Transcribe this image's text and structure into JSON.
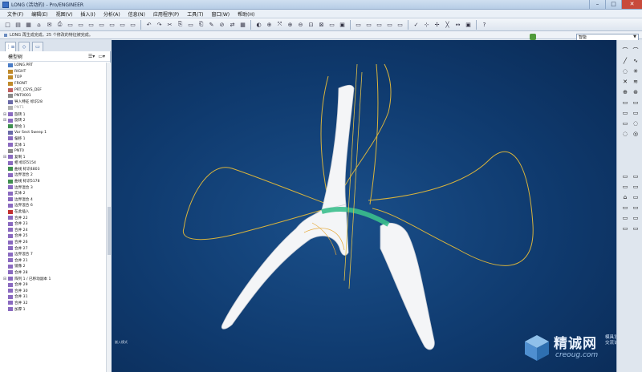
{
  "window": {
    "title": "LONG (活动的) - Pro/ENGINEER",
    "min": "–",
    "max": "□",
    "close": "✕"
  },
  "menu": [
    "文件(F)",
    "编辑(E)",
    "视图(V)",
    "插入(I)",
    "分析(A)",
    "信息(N)",
    "应用程序(P)",
    "工具(T)",
    "窗口(W)",
    "帮助(H)"
  ],
  "toolbar": {
    "groups": [
      [
        "□",
        "▤",
        "▦",
        "⌂",
        "✉",
        "⎙",
        "▭",
        "▭",
        "▭",
        "▭",
        "▭",
        "▭",
        "▭"
      ],
      [
        "↶",
        "↷",
        "✂",
        "⎘",
        "▭",
        "⎗",
        "✎",
        "⊘",
        "⇄",
        "▦"
      ],
      [
        "◐",
        "⊕",
        "⤧",
        "⊕",
        "⊖",
        "⊡",
        "⊠",
        "▭",
        "▣"
      ],
      [
        "▭",
        "▭",
        "▭",
        "▭",
        "▭"
      ],
      [
        "✓",
        "⊹",
        "✢",
        "╳",
        "↔",
        "▣"
      ],
      [
        "?"
      ]
    ]
  },
  "message": "LONG 再生成完成。25 个修改的特征被完成。",
  "filter": {
    "selected": "智能",
    "arrow": "▼"
  },
  "navigator": {
    "tabs": [
      "⋮≡",
      "◇",
      "▭"
    ],
    "header": "模型树",
    "tools": [
      "☰▾",
      "▭▾"
    ],
    "items": [
      {
        "label": "LONG.PRT",
        "twist": "",
        "icon": "#4a7cc6"
      },
      {
        "label": "RIGHT",
        "twist": "",
        "icon": "#c08a2a"
      },
      {
        "label": "TOP",
        "twist": "",
        "icon": "#c08a2a"
      },
      {
        "label": "FRONT",
        "twist": "",
        "icon": "#c08a2a"
      },
      {
        "label": "PRT_CSYS_DEF",
        "twist": "",
        "icon": "#c06060"
      },
      {
        "label": "PNT0001",
        "twist": "",
        "icon": "#8a8a8a"
      },
      {
        "label": "导入特征 标识28",
        "twist": "",
        "icon": "#6a6aa8"
      },
      {
        "label": "PNT1",
        "twist": "",
        "icon": "#b0b0b0",
        "grey": true
      },
      {
        "label": "旋转 1",
        "twist": "⊞",
        "icon": "#8a6ac0"
      },
      {
        "label": "旋转 2",
        "twist": "⊞",
        "icon": "#8a6ac0"
      },
      {
        "label": "草绘 1",
        "twist": "",
        "icon": "#3f8f4f"
      },
      {
        "label": "Var Sect Sweep 1",
        "twist": "",
        "icon": "#6a6aa8"
      },
      {
        "label": "偏移 1",
        "twist": "",
        "icon": "#8a6ac0"
      },
      {
        "label": "实体 1",
        "twist": "",
        "icon": "#8a6ac0"
      },
      {
        "label": "PNT0",
        "twist": "",
        "icon": "#8a8a8a"
      },
      {
        "label": "复制 1",
        "twist": "⊞",
        "icon": "#8a6ac0"
      },
      {
        "label": "相 标识5154",
        "twist": "",
        "icon": "#8a6ac0"
      },
      {
        "label": "曲线 标识4803",
        "twist": "",
        "icon": "#3f8f4f"
      },
      {
        "label": "边界混合 2",
        "twist": "",
        "icon": "#8a6ac0"
      },
      {
        "label": "曲线 标识5178",
        "twist": "",
        "icon": "#3f8f4f"
      },
      {
        "label": "边界混合 3",
        "twist": "",
        "icon": "#8a6ac0"
      },
      {
        "label": "实体 2",
        "twist": "",
        "icon": "#8a6ac0"
      },
      {
        "label": "边界混合 4",
        "twist": "",
        "icon": "#8a6ac0"
      },
      {
        "label": "边界混合 6",
        "twist": "",
        "icon": "#8a6ac0"
      },
      {
        "label": "在此插入",
        "twist": "",
        "icon": "#c23030"
      },
      {
        "label": "合并 22",
        "twist": "",
        "icon": "#8a6ac0"
      },
      {
        "label": "合并 23",
        "twist": "",
        "icon": "#8a6ac0"
      },
      {
        "label": "合并 24",
        "twist": "",
        "icon": "#8a6ac0"
      },
      {
        "label": "合并 25",
        "twist": "",
        "icon": "#8a6ac0"
      },
      {
        "label": "合并 26",
        "twist": "",
        "icon": "#8a6ac0"
      },
      {
        "label": "合并 27",
        "twist": "",
        "icon": "#8a6ac0"
      },
      {
        "label": "边界混合 7",
        "twist": "",
        "icon": "#8a6ac0"
      },
      {
        "label": "合并 21",
        "twist": "",
        "icon": "#8a6ac0"
      },
      {
        "label": "镜像 2",
        "twist": "",
        "icon": "#8a6ac0"
      },
      {
        "label": "合并 28",
        "twist": "",
        "icon": "#8a6ac0"
      },
      {
        "label": "阵列 1 / 已移动副本 1",
        "twist": "⊞",
        "icon": "#8a6ac0"
      },
      {
        "label": "合并 29",
        "twist": "",
        "icon": "#8a6ac0"
      },
      {
        "label": "合并 30",
        "twist": "",
        "icon": "#8a6ac0"
      },
      {
        "label": "合并 31",
        "twist": "",
        "icon": "#8a6ac0"
      },
      {
        "label": "合并 32",
        "twist": "",
        "icon": "#8a6ac0"
      },
      {
        "label": "加厚 1",
        "twist": "",
        "icon": "#8a6ac0"
      }
    ]
  },
  "viewport": {
    "coord_label": "嵌入模式"
  },
  "watermark": {
    "brand": "精诚网",
    "sub1": "模具设计",
    "sub2": "交流论坛",
    "url": "creoug.com"
  },
  "right_tools": [
    "⌒",
    "⌒",
    "╱",
    "∿",
    "◌",
    "✳",
    "✕",
    "≋",
    "⊕",
    "⊛",
    "▭",
    "▭",
    "▭",
    "▭",
    "▭",
    "◌",
    "◌",
    "◎",
    "▭",
    "▭",
    "▭",
    "▭",
    "⌂",
    "▭",
    "▭",
    "▭",
    "▭",
    "▭",
    "▭",
    "▭"
  ]
}
